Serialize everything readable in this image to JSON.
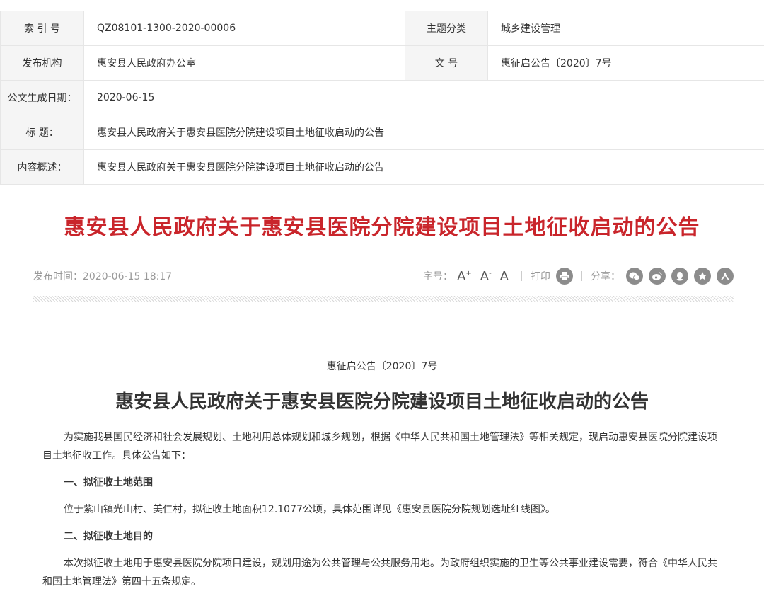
{
  "meta": {
    "index_label": "索 引 号",
    "index_value": "QZ08101-1300-2020-00006",
    "topic_label": "主题分类",
    "topic_value": "城乡建设管理",
    "publisher_label": "发布机构",
    "publisher_value": "惠安县人民政府办公室",
    "docnum_label": "文 号",
    "docnum_value": "惠征启公告〔2020〕7号",
    "date_label": "公文生成日期：",
    "date_value": "2020-06-15",
    "title_label": "标 题：",
    "title_value": "惠安县人民政府关于惠安县医院分院建设项目土地征收启动的公告",
    "summary_label": "内容概述：",
    "summary_value": "惠安县人民政府关于惠安县医院分院建设项目土地征收启动的公告"
  },
  "article": {
    "title": "惠安县人民政府关于惠安县医院分院建设项目土地征收启动的公告",
    "publish_time": "发布时间：2020-06-15 18:17",
    "font_label": "字号：",
    "font_large": "A",
    "font_medium": "A",
    "font_small": "A",
    "print_label": "打印",
    "share_label": "分享：",
    "share_icons": [
      "wechat-icon",
      "weibo-icon",
      "qq-icon",
      "qzone-icon",
      "renren-icon"
    ],
    "doc_number": "惠征启公告〔2020〕7号",
    "subtitle": "惠安县人民政府关于惠安县医院分院建设项目土地征收启动的公告",
    "para1": "为实施我县国民经济和社会发展规划、土地利用总体规划和城乡规划，根据《中华人民共和国土地管理法》等相关规定，现启动惠安县医院分院建设项目土地征收工作。具体公告如下：",
    "heading1": "一、拟征收土地范围",
    "para2": "位于紫山镇光山村、美仁村，拟征收土地面积12.1077公顷，具体范围详见《惠安县医院分院规划选址红线图》。",
    "heading2": "二、拟征收土地目的",
    "para3": "本次拟征收土地用于惠安县医院分院项目建设，规划用途为公共管理与公共服务用地。为政府组织实施的卫生等公共事业建设需要，符合《中华人民共和国土地管理法》第四十五条规定。"
  },
  "colors": {
    "title_red": "#c9252b",
    "label_bg": "#f5f5f5",
    "border": "#e6e6e6",
    "icon_gray": "#8c8c8c"
  }
}
